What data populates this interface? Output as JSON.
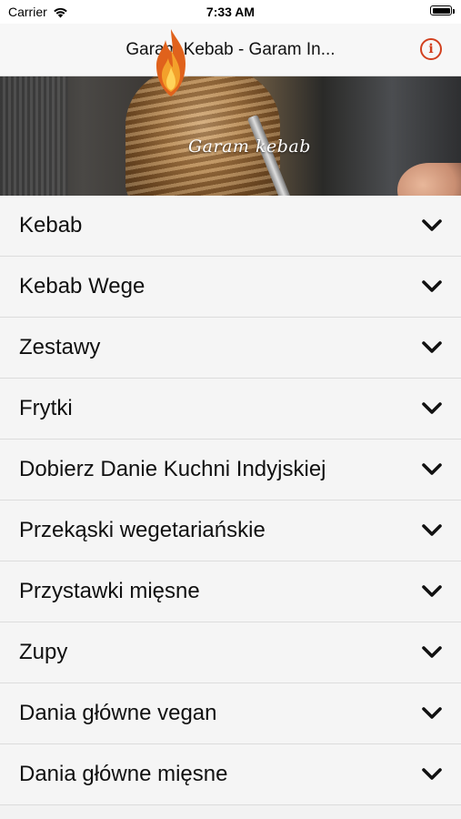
{
  "status_bar": {
    "carrier": "Carrier",
    "time": "7:33 AM",
    "battery_level": 1.0,
    "icons": [
      "wifi-icon",
      "battery-icon"
    ]
  },
  "nav_bar": {
    "title": "Garam Kebab - Garam In...",
    "info_icon": "info-icon",
    "info_symbol": "i",
    "accent_color": "#d2401e"
  },
  "hero": {
    "logo_text": "Garam kebab",
    "flame_icon": "flame-logo-icon"
  },
  "menu": {
    "chevron_icon": "chevron-down-icon",
    "categories": [
      {
        "label": "Kebab"
      },
      {
        "label": "Kebab Wege"
      },
      {
        "label": "Zestawy"
      },
      {
        "label": "Frytki"
      },
      {
        "label": "Dobierz Danie Kuchni Indyjskiej"
      },
      {
        "label": "Przekąski wegetariańskie"
      },
      {
        "label": "Przystawki mięsne"
      },
      {
        "label": "Zupy"
      },
      {
        "label": "Dania główne vegan"
      },
      {
        "label": "Dania główne mięsne"
      }
    ]
  },
  "colors": {
    "background": "#f2f2f2",
    "row_background": "#f5f5f5",
    "text": "#111111",
    "accent": "#d2401e"
  }
}
